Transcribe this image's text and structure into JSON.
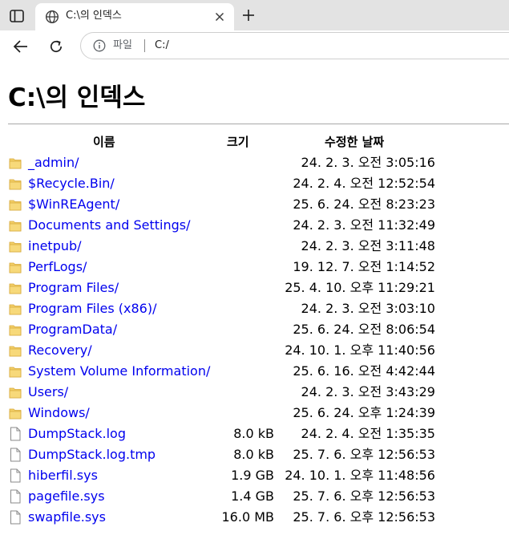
{
  "browser": {
    "tab_title": "C:\\의 인덱스",
    "scheme_label": "파일",
    "url": "C:/"
  },
  "page": {
    "title": "C:\\의 인덱스",
    "columns": {
      "name": "이름",
      "size": "크기",
      "modified": "수정한 날짜"
    },
    "entries": [
      {
        "type": "folder",
        "name": "_admin/",
        "size": "",
        "modified": "24. 2. 3. 오전 3:05:16"
      },
      {
        "type": "folder",
        "name": "$Recycle.Bin/",
        "size": "",
        "modified": "24. 2. 4. 오전 12:52:54"
      },
      {
        "type": "folder",
        "name": "$WinREAgent/",
        "size": "",
        "modified": "25. 6. 24. 오전 8:23:23"
      },
      {
        "type": "folder",
        "name": "Documents and Settings/",
        "size": "",
        "modified": "24. 2. 3. 오전 11:32:49"
      },
      {
        "type": "folder",
        "name": "inetpub/",
        "size": "",
        "modified": "24. 2. 3. 오전 3:11:48"
      },
      {
        "type": "folder",
        "name": "PerfLogs/",
        "size": "",
        "modified": "19. 12. 7. 오전 1:14:52"
      },
      {
        "type": "folder",
        "name": "Program Files/",
        "size": "",
        "modified": "25. 4. 10. 오후 11:29:21"
      },
      {
        "type": "folder",
        "name": "Program Files (x86)/",
        "size": "",
        "modified": "24. 2. 3. 오전 3:03:10"
      },
      {
        "type": "folder",
        "name": "ProgramData/",
        "size": "",
        "modified": "25. 6. 24. 오전 8:06:54"
      },
      {
        "type": "folder",
        "name": "Recovery/",
        "size": "",
        "modified": "24. 10. 1. 오후 11:40:56"
      },
      {
        "type": "folder",
        "name": "System Volume Information/",
        "size": "",
        "modified": "25. 6. 16. 오전 4:42:44"
      },
      {
        "type": "folder",
        "name": "Users/",
        "size": "",
        "modified": "24. 2. 3. 오전 3:43:29"
      },
      {
        "type": "folder",
        "name": "Windows/",
        "size": "",
        "modified": "25. 6. 24. 오후 1:24:39"
      },
      {
        "type": "file",
        "name": "DumpStack.log",
        "size": "8.0 kB",
        "modified": "24. 2. 4. 오전 1:35:35"
      },
      {
        "type": "file",
        "name": "DumpStack.log.tmp",
        "size": "8.0 kB",
        "modified": "25. 7. 6. 오후 12:56:53"
      },
      {
        "type": "file",
        "name": "hiberfil.sys",
        "size": "1.9 GB",
        "modified": "24. 10. 1. 오후 11:48:56"
      },
      {
        "type": "file",
        "name": "pagefile.sys",
        "size": "1.4 GB",
        "modified": "25. 7. 6. 오후 12:56:53"
      },
      {
        "type": "file",
        "name": "swapfile.sys",
        "size": "16.0 MB",
        "modified": "25. 7. 6. 오후 12:56:53"
      }
    ]
  },
  "colors": {
    "link": "#0000ee",
    "folder_icon": "#f0c85a",
    "tabstrip": "#e3e3e3"
  }
}
